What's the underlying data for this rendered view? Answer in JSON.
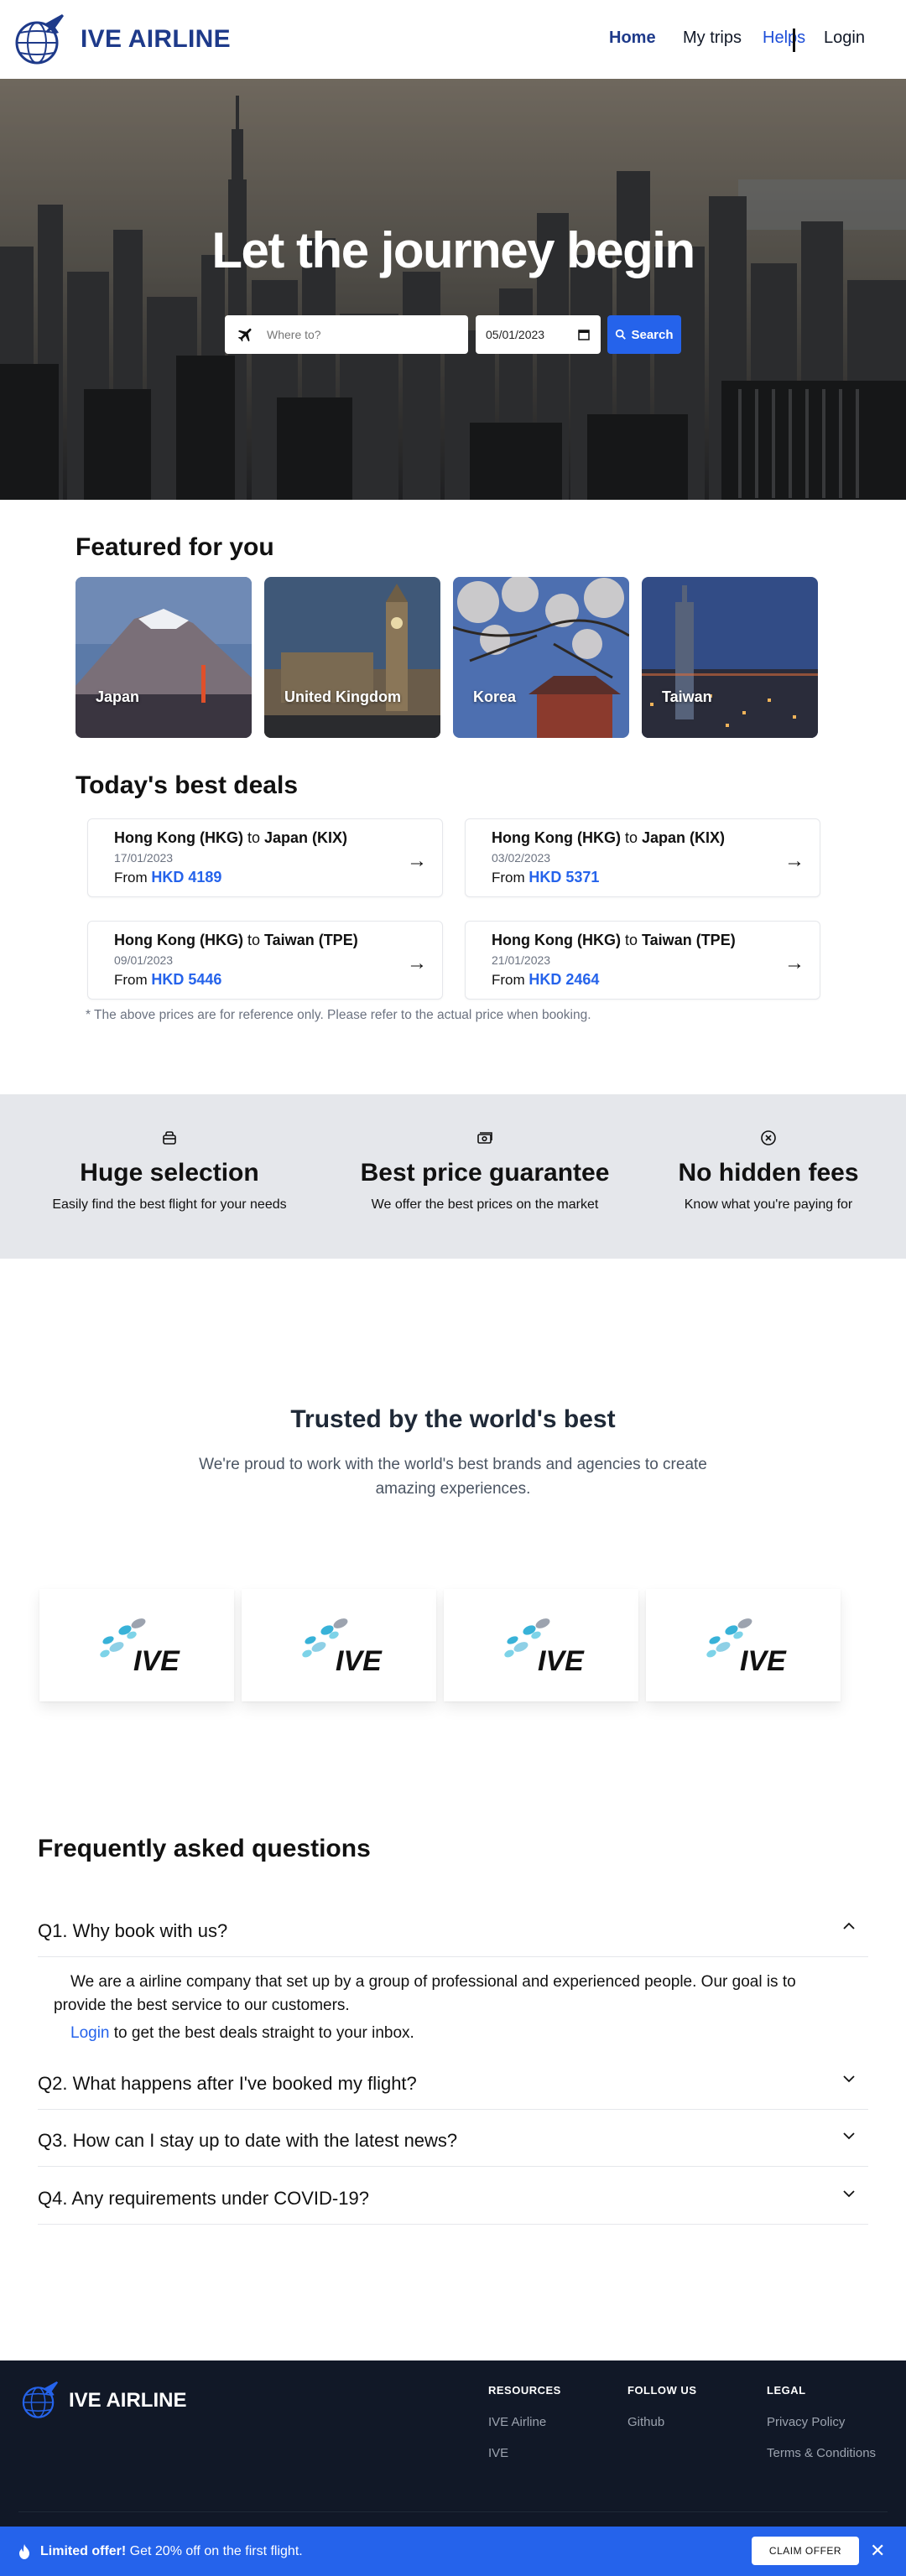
{
  "header": {
    "brand": "IVE AIRLINE",
    "nav": {
      "home": "Home",
      "trips": "My trips",
      "helps": "Helps",
      "login": "Login"
    }
  },
  "hero": {
    "title": "Let the journey begin",
    "search_placeholder": "Where to?",
    "date_value": "05/01/2023",
    "search_label": "Search"
  },
  "featured": {
    "title": "Featured for you",
    "items": [
      {
        "label": "Japan"
      },
      {
        "label": "United Kingdom"
      },
      {
        "label": "Korea"
      },
      {
        "label": "Taiwan"
      }
    ]
  },
  "deals": {
    "title": "Today's best deals",
    "items": [
      {
        "from": "Hong Kong (HKG)",
        "to_word": "to",
        "to": "Japan (KIX)",
        "date": "17/01/2023",
        "from_word": "From",
        "price": "HKD 4189"
      },
      {
        "from": "Hong Kong (HKG)",
        "to_word": "to",
        "to": "Japan (KIX)",
        "date": "03/02/2023",
        "from_word": "From",
        "price": "HKD 5371"
      },
      {
        "from": "Hong Kong (HKG)",
        "to_word": "to",
        "to": "Taiwan (TPE)",
        "date": "09/01/2023",
        "from_word": "From",
        "price": "HKD 5446"
      },
      {
        "from": "Hong Kong (HKG)",
        "to_word": "to",
        "to": "Taiwan (TPE)",
        "date": "21/01/2023",
        "from_word": "From",
        "price": "HKD 2464"
      }
    ],
    "arrow": "→",
    "disclaimer": "* The above prices are for reference only. Please refer to the actual price when booking."
  },
  "features": [
    {
      "icon": "bag-icon",
      "title": "Huge selection",
      "text": "Easily find the best flight for your needs"
    },
    {
      "icon": "money-icon",
      "title": "Best price guarantee",
      "text": "We offer the best prices on the market"
    },
    {
      "icon": "no-fee-icon",
      "title": "No hidden fees",
      "text": "Know what you're paying for"
    }
  ],
  "trusted": {
    "title": "Trusted by the world's best",
    "subtitle": "We're proud to work with the world's best brands and agencies to create amazing experiences.",
    "partners": [
      "IVE",
      "IVE",
      "IVE",
      "IVE"
    ]
  },
  "faq": {
    "title": "Frequently asked questions",
    "items": [
      {
        "q": "Q1. Why book with us?",
        "open": true
      },
      {
        "q": "Q2. What happens after I've booked my flight?",
        "open": false
      },
      {
        "q": "Q3. How can I stay up to date with the latest news?",
        "open": false
      },
      {
        "q": "Q4. Any requirements under COVID-19?",
        "open": false
      }
    ],
    "answer": "We are a airline company that set up by a group of professional and experienced people. Our goal is to provide the best service to our customers.",
    "answer_link": "Login",
    "answer_tail": "to get the best deals straight to your inbox."
  },
  "footer": {
    "brand": "IVE AIRLINE",
    "columns": [
      {
        "title": "RESOURCES",
        "links": [
          "IVE Airline",
          "IVE"
        ]
      },
      {
        "title": "FOLLOW US",
        "links": [
          "Github"
        ]
      },
      {
        "title": "LEGAL",
        "links": [
          "Privacy Policy",
          "Terms & Conditions"
        ]
      }
    ]
  },
  "banner": {
    "bold": "Limited offer!",
    "text": "Get 20% off on the first flight.",
    "cta": "CLAIM OFFER",
    "close": "✕"
  },
  "colors": {
    "brand": "#1e3a8a",
    "accent": "#2563eb",
    "footer": "#111827",
    "band": "#e5e7eb"
  }
}
